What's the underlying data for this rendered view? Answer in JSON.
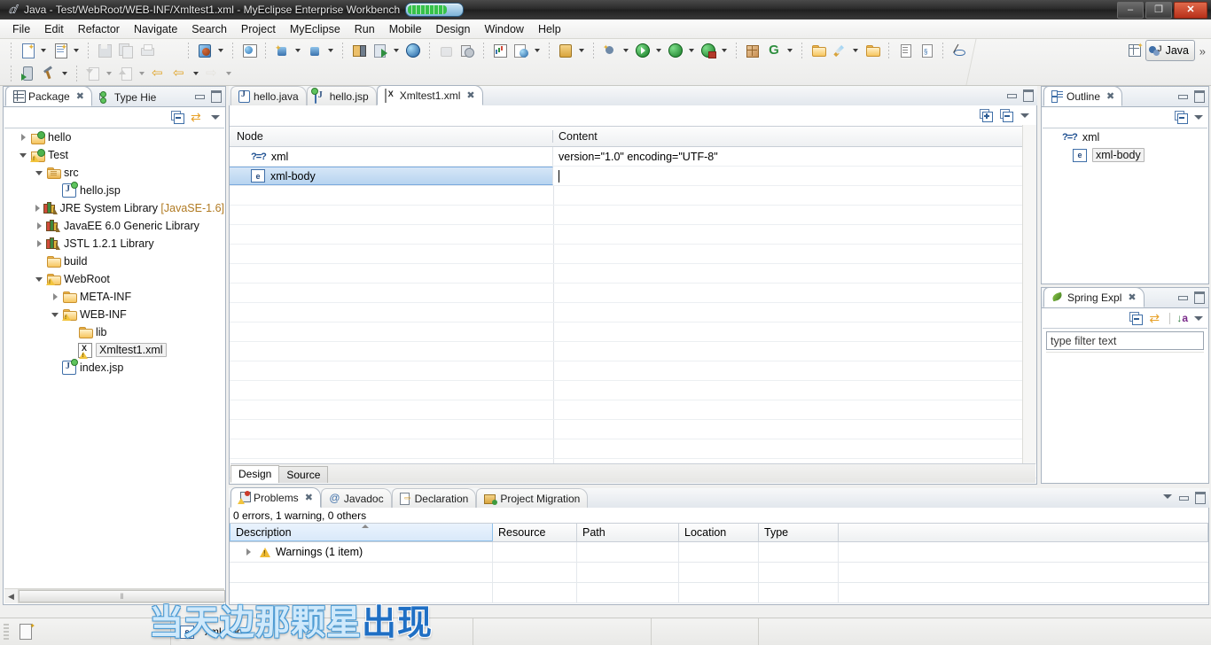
{
  "window": {
    "title": "Java - Test/WebRoot/WEB-INF/Xmltest1.xml - MyEclipse Enterprise Workbench",
    "minimize_label": "–",
    "restore_label": "❐",
    "close_label": "✕"
  },
  "menubar": {
    "items": [
      "File",
      "Edit",
      "Refactor",
      "Navigate",
      "Search",
      "Project",
      "MyEclipse",
      "Run",
      "Mobile",
      "Design",
      "Window",
      "Help"
    ]
  },
  "toolbar": {
    "overflow_label": "»",
    "perspective_label": "Java",
    "row1_icons": [
      "new-wizard-icon",
      "new-wizard-dropdown",
      "new-java-class-icon",
      "new-class-dropdown",
      "save-icon",
      "save-all-icon",
      "print-icon",
      "deploy-myeclipse-icon",
      "deploy-dropdown",
      "web-browser-icon",
      "new-db-connection-icon",
      "db-connection-dropdown",
      "open-db-icon",
      "open-db-dropdown",
      "server-config-icon",
      "run-server-icon",
      "run-server-dropdown",
      "globe-icon",
      "thumbs-up-icon",
      "history-icon",
      "report-icon",
      "web-world-icon",
      "web-world-dropdown",
      "open-type-icon",
      "open-type-dropdown",
      "debug-icon",
      "debug-dropdown",
      "run-icon",
      "run-dropdown",
      "run-history-icon",
      "run-history-dropdown",
      "coverage-icon",
      "coverage-dropdown",
      "new-package-icon",
      "new-annotation-icon",
      "annotation-dropdown",
      "open-resource-icon",
      "search-pen-icon",
      "search-dropdown",
      "open-folder-icon",
      "next-annotation-icon",
      "prev-annotation-icon",
      "toggle-mark-icon"
    ],
    "row2_icons": [
      "mobile-run-icon",
      "build-hammer-icon",
      "build-dropdown",
      "import-icon",
      "import-dropdown",
      "export-icon",
      "export-dropdown",
      "back-history-icon",
      "back-icon",
      "back-dropdown",
      "forward-icon",
      "forward-dropdown"
    ]
  },
  "package_explorer": {
    "tabs": [
      {
        "label": "Package",
        "icon": "package-explorer-icon",
        "active": true,
        "closeable": true
      },
      {
        "label": "Type Hie",
        "icon": "type-hierarchy-icon",
        "active": false,
        "closeable": false
      }
    ],
    "view_toolbar": [
      "collapse-all-icon",
      "link-with-editor-icon",
      "view-menu-icon"
    ],
    "tree": [
      {
        "label": "hello",
        "indent": 0,
        "twisty": "closed",
        "icon": "project-folder-closed-icon"
      },
      {
        "label": "Test",
        "indent": 0,
        "twisty": "open",
        "icon": "project-warning-icon"
      },
      {
        "label": "src",
        "indent": 1,
        "twisty": "open",
        "icon": "source-folder-icon"
      },
      {
        "label": "hello.jsp",
        "indent": 2,
        "twisty": "none",
        "icon": "jsp-file-icon"
      },
      {
        "label": "JRE System Library",
        "suffix": " [JavaSE-1.6]",
        "indent": 1,
        "twisty": "closed",
        "icon": "library-icon"
      },
      {
        "label": "JavaEE 6.0 Generic Library",
        "indent": 1,
        "twisty": "closed",
        "icon": "library-icon"
      },
      {
        "label": "JSTL 1.2.1 Library",
        "indent": 1,
        "twisty": "closed",
        "icon": "library-icon"
      },
      {
        "label": "build",
        "indent": 1,
        "twisty": "none",
        "icon": "folder-icon"
      },
      {
        "label": "WebRoot",
        "indent": 1,
        "twisty": "open",
        "icon": "webroot-folder-icon"
      },
      {
        "label": "META-INF",
        "indent": 2,
        "twisty": "closed",
        "icon": "folder-icon"
      },
      {
        "label": "WEB-INF",
        "indent": 2,
        "twisty": "open",
        "icon": "webinf-folder-icon"
      },
      {
        "label": "lib",
        "indent": 3,
        "twisty": "none",
        "icon": "folder-icon"
      },
      {
        "label": "Xmltest1.xml",
        "indent": 3,
        "twisty": "none",
        "icon": "xml-file-warning-icon",
        "selected": true
      },
      {
        "label": "index.jsp",
        "indent": 2,
        "twisty": "none",
        "icon": "jsp-file-icon"
      }
    ],
    "hscrollbar": {
      "left_arrow": "◀",
      "thumb_grip": "‖"
    }
  },
  "editor": {
    "tabs": [
      {
        "label": "hello.java",
        "icon": "java-file-icon",
        "active": false,
        "closeable": false
      },
      {
        "label": "hello.jsp",
        "icon": "jsp-file-icon",
        "active": false,
        "closeable": false
      },
      {
        "label": "Xmltest1.xml",
        "icon": "xml-file-icon",
        "active": true,
        "closeable": true
      }
    ],
    "view_toolbar": [
      "expand-all-icon",
      "collapse-all-icon",
      "view-menu-icon"
    ],
    "columns": [
      "Node",
      "Content"
    ],
    "rows": [
      {
        "node": "xml",
        "icon": "processing-instruction-icon",
        "content": "version=\"1.0\" encoding=\"UTF-8\"",
        "selected": false
      },
      {
        "node": "xml-body",
        "icon": "element-icon",
        "content": "",
        "selected": true,
        "editing": true
      }
    ],
    "page_tabs": [
      {
        "label": "Design",
        "active": true
      },
      {
        "label": "Source",
        "active": false
      }
    ]
  },
  "outline": {
    "tabs": [
      {
        "label": "Outline",
        "icon": "outline-icon",
        "active": true,
        "closeable": true
      }
    ],
    "view_toolbar": [
      "collapse-all-icon",
      "view-menu-icon"
    ],
    "items": [
      {
        "label": "xml",
        "icon": "processing-instruction-icon",
        "selected": false
      },
      {
        "label": "xml-body",
        "icon": "element-icon",
        "selected": true
      }
    ]
  },
  "spring_explorer": {
    "tabs": [
      {
        "label": "Spring Expl",
        "icon": "spring-leaf-icon",
        "active": true,
        "closeable": true
      }
    ],
    "view_toolbar": [
      "collapse-all-icon",
      "link-with-editor-icon",
      "sort-icon",
      "view-menu-icon"
    ],
    "filter_placeholder": "type filter text"
  },
  "problems": {
    "tabs": [
      {
        "label": "Problems",
        "icon": "problems-icon",
        "active": true,
        "closeable": true
      },
      {
        "label": "Javadoc",
        "icon": "javadoc-icon",
        "active": false,
        "closeable": false
      },
      {
        "label": "Declaration",
        "icon": "declaration-icon",
        "active": false,
        "closeable": false
      },
      {
        "label": "Project Migration",
        "icon": "project-migration-icon",
        "active": false,
        "closeable": false
      }
    ],
    "summary": "0 errors, 1 warning, 0 others",
    "columns": [
      "Description",
      "Resource",
      "Path",
      "Location",
      "Type"
    ],
    "rows": [
      {
        "twisty": "closed",
        "icon": "warning-icon",
        "description": "Warnings (1 item)",
        "resource": "",
        "path": "",
        "location": "",
        "type": ""
      }
    ],
    "view_toolbar": [
      "view-menu-icon",
      "minimize-icon",
      "maximize-icon"
    ]
  },
  "statusbar": {
    "selection_icon": "editor-selection-icon",
    "element_icon": "element-icon",
    "element_label": "xml-body"
  },
  "watermark": {
    "sung_text": "出现",
    "unsung_text": "当天边那颗星",
    "sung_color": "#1f6fc4",
    "unsung_color": "#cfe9fb"
  }
}
